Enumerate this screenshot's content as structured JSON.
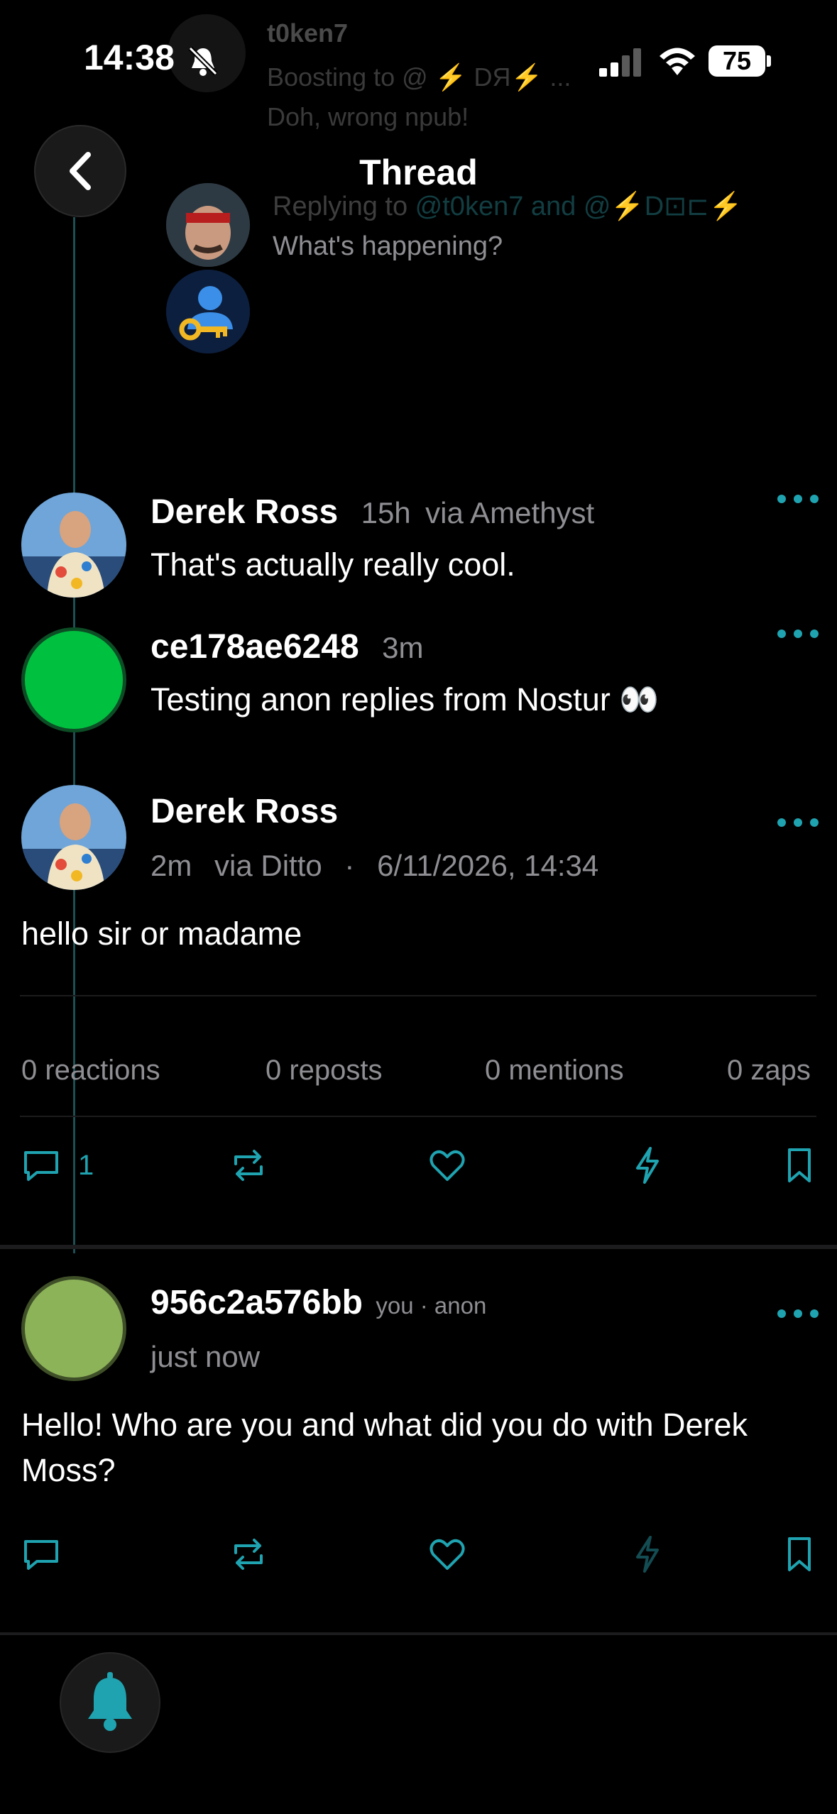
{
  "status_bar": {
    "time": "14:38",
    "battery": "75"
  },
  "background": {
    "author": "t0ken7",
    "line1": "Boosting to @ ⚡ DЯ⚡ ...",
    "line2": "Doh, wrong npub!",
    "replying_prefix": "Replying to ",
    "replying_to": "@t0ken7 and @⚡D⊡⊏⚡",
    "composer_placeholder": "What's happening?"
  },
  "header": {
    "title": "Thread"
  },
  "posts": [
    {
      "name": "Derek Ross",
      "time": "15h",
      "client": "via Amethyst",
      "text": "That's actually really cool."
    },
    {
      "name": "ce178ae6248",
      "time": "3m",
      "client": "",
      "text": "Testing anon replies from Nostur 👀"
    }
  ],
  "main_post": {
    "name": "Derek Ross",
    "time": "2m",
    "client": "via Ditto",
    "separator": "·",
    "date": "6/11/2026, 14:34",
    "text": "hello sir or madame",
    "stats": {
      "reactions": "0 reactions",
      "reposts": "0 reposts",
      "mentions": "0 mentions",
      "zaps": "0 zaps"
    },
    "reply_count": "1"
  },
  "reply_post": {
    "name": "956c2a576bb",
    "tag": "you · anon",
    "time": "just now",
    "text": "Hello! Who are you and what did you do with Derek Moss?"
  },
  "colors": {
    "accent": "#1fa3b0",
    "anon_green": "#00c13f",
    "anon_olive": "#8db359"
  }
}
